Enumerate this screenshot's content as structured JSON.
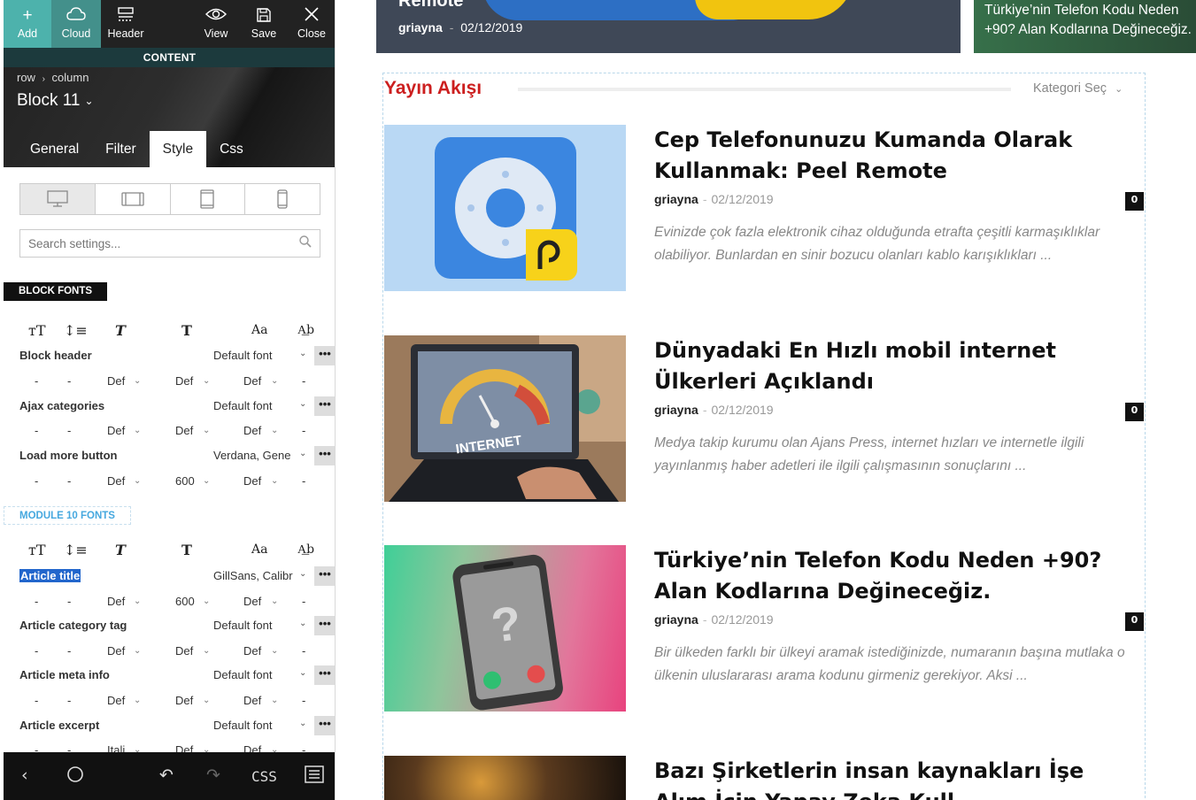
{
  "toolbar": {
    "add": "Add",
    "cloud": "Cloud",
    "header": "Header",
    "view": "View",
    "save": "Save",
    "close": "Close"
  },
  "content_label": "CONTENT",
  "breadcrumb": [
    "row",
    "column"
  ],
  "block_title": "Block 11",
  "tabs": [
    "General",
    "Filter",
    "Style",
    "Css"
  ],
  "active_tab": "Style",
  "search_placeholder": "Search settings...",
  "block_fonts": {
    "label": "BLOCK FONTS",
    "rows": [
      {
        "name": "Block header",
        "font": "Default font",
        "vals": [
          "-",
          "-",
          "Def",
          "Def",
          "Def",
          "-"
        ]
      },
      {
        "name": "Ajax categories",
        "font": "Default font",
        "vals": [
          "-",
          "-",
          "Def",
          "Def",
          "Def",
          "-"
        ]
      },
      {
        "name": "Load more button",
        "font": "Verdana, Gene",
        "vals": [
          "-",
          "-",
          "Def",
          "600",
          "Def",
          "-"
        ]
      }
    ]
  },
  "module_fonts": {
    "label": "MODULE 10 FONTS",
    "rows": [
      {
        "name": "Article title",
        "font": "GillSans, Calibr",
        "vals": [
          "-",
          "-",
          "Def",
          "600",
          "Def",
          "-"
        ]
      },
      {
        "name": "Article category tag",
        "font": "Default font",
        "vals": [
          "-",
          "-",
          "Def",
          "Def",
          "Def",
          "-"
        ]
      },
      {
        "name": "Article meta info",
        "font": "Default font",
        "vals": [
          "-",
          "-",
          "Def",
          "Def",
          "Def",
          "-"
        ]
      },
      {
        "name": "Article excerpt",
        "font": "Default font",
        "vals": [
          "-",
          "-",
          "Itali",
          "Def",
          "Def",
          "-"
        ]
      }
    ]
  },
  "more_glyph": "•••",
  "bottombar": {
    "css": "CSS"
  },
  "hero_left": {
    "title": "Remote",
    "author": "griayna",
    "date": "02/12/2019"
  },
  "hero_right": {
    "title": "Türkiye’nin Telefon Kodu Neden +90? Alan Kodlarına Değineceğiz."
  },
  "feed": {
    "title": "Yayın Akışı",
    "category_select": "Kategori Seç",
    "articles": [
      {
        "title": "Cep Telefonunuzu Kumanda Olarak Kullanmak: Peel Remote",
        "author": "griayna",
        "date": "02/12/2019",
        "count": "0",
        "excerpt": "Evinizde çok fazla elektronik cihaz olduğunda etrafta çeşitli karmaşıklıklar olabiliyor. Bunlardan en sinir bozucu olanları kablo karışıklıkları ..."
      },
      {
        "title": "Dünyadaki En Hızlı mobil internet Ülkerleri Açıklandı",
        "author": "griayna",
        "date": "02/12/2019",
        "count": "0",
        "excerpt": "Medya takip kurumu olan Ajans Press, internet hızları ve internetle ilgili yayınlanmış haber adetleri ile ilgili çalışmasının sonuçlarını ..."
      },
      {
        "title": "Türkiye’nin Telefon Kodu Neden +90? Alan Kodlarına Değineceğiz.",
        "author": "griayna",
        "date": "02/12/2019",
        "count": "0",
        "excerpt": "Bir ülkeden farklı bir ülkeyi aramak istediğinizde, numaranın başına mutlaka o ülkenin uluslararası arama kodunu girmeniz gerekiyor. Aksi ..."
      },
      {
        "title": "Bazı Şirketlerin insan kaynakları İşe Alım İçin Yapay Zeka Kull..."
      }
    ]
  },
  "thumb_text": {
    "internet": "INTERNET",
    "question": "?"
  },
  "colors": {
    "accent_teal": "#4db2ac",
    "feed_title_red": "#cc1f1f",
    "selected_blue": "#2266cc"
  }
}
